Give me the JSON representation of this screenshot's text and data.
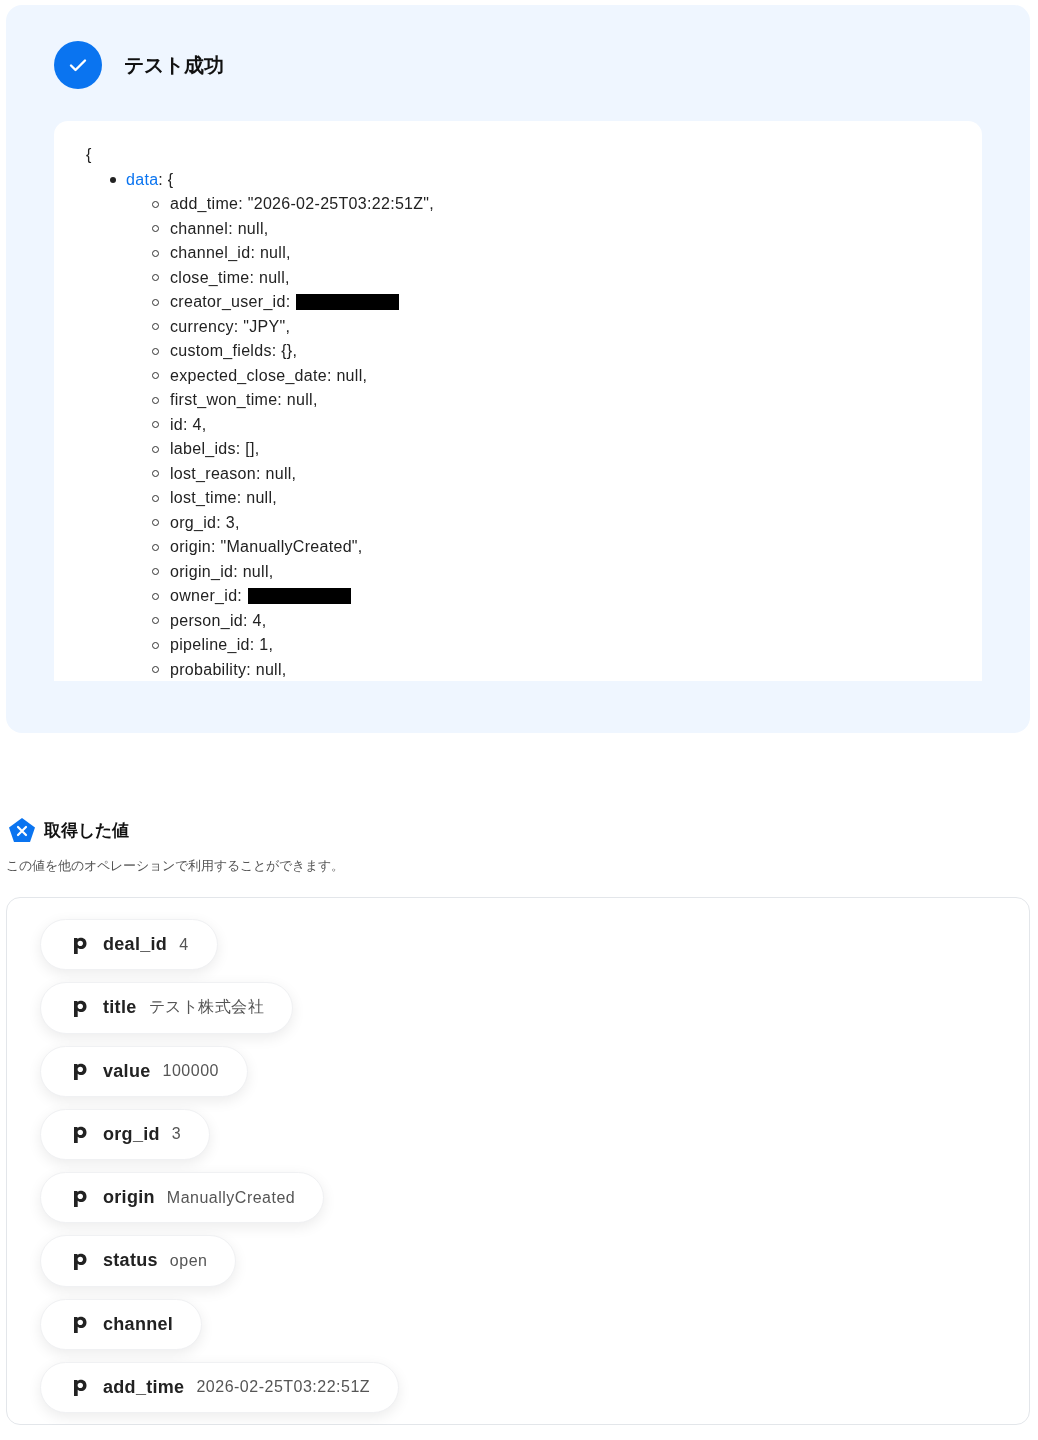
{
  "result": {
    "title": "テスト成功",
    "open_brace": "{",
    "data_key": "data",
    "data_open": ": {",
    "fields": [
      {
        "text": "add_time: \"2026-02-25T03:22:51Z\",",
        "redacted": false
      },
      {
        "text": "channel: null,",
        "redacted": false
      },
      {
        "text": "channel_id: null,",
        "redacted": false
      },
      {
        "text": "close_time: null,",
        "redacted": false
      },
      {
        "text": "creator_user_id:",
        "redacted": true
      },
      {
        "text": "currency: \"JPY\",",
        "redacted": false
      },
      {
        "text": "custom_fields: {},",
        "redacted": false
      },
      {
        "text": "expected_close_date: null,",
        "redacted": false
      },
      {
        "text": "first_won_time: null,",
        "redacted": false
      },
      {
        "text": "id: 4,",
        "redacted": false
      },
      {
        "text": "label_ids: [],",
        "redacted": false
      },
      {
        "text": "lost_reason: null,",
        "redacted": false
      },
      {
        "text": "lost_time: null,",
        "redacted": false
      },
      {
        "text": "org_id: 3,",
        "redacted": false
      },
      {
        "text": "origin: \"ManuallyCreated\",",
        "redacted": false
      },
      {
        "text": "origin_id: null,",
        "redacted": false
      },
      {
        "text": "owner_id:",
        "redacted": true
      },
      {
        "text": "person_id: 4,",
        "redacted": false
      },
      {
        "text": "pipeline_id: 1,",
        "redacted": false
      },
      {
        "text": "probability: null,",
        "redacted": false
      }
    ]
  },
  "values": {
    "title": "取得した値",
    "description": "この値を他のオペレーションで利用することができます。",
    "items": [
      {
        "key": "deal_id",
        "value": "4"
      },
      {
        "key": "title",
        "value": "テスト株式会社"
      },
      {
        "key": "value",
        "value": "100000"
      },
      {
        "key": "org_id",
        "value": "3"
      },
      {
        "key": "origin",
        "value": "ManuallyCreated"
      },
      {
        "key": "status",
        "value": "open"
      },
      {
        "key": "channel"
      },
      {
        "key": "add_time",
        "value": "2026-02-25T03:22:51Z"
      }
    ]
  }
}
